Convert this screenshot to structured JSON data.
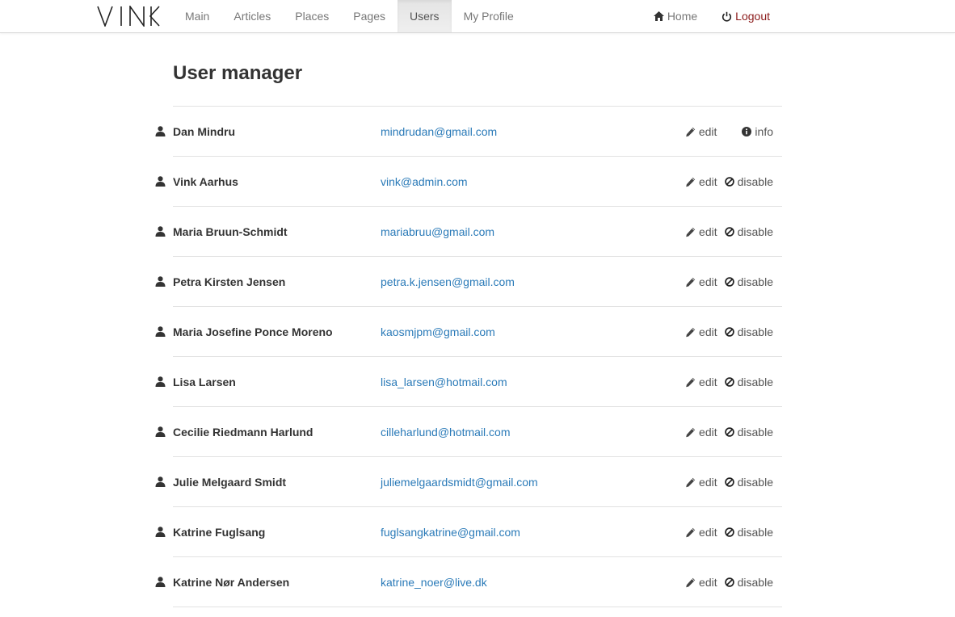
{
  "brand": {
    "logo_text": "VINK"
  },
  "nav": {
    "items": [
      {
        "label": "Main"
      },
      {
        "label": "Articles"
      },
      {
        "label": "Places"
      },
      {
        "label": "Pages"
      },
      {
        "label": "Users",
        "active": true
      },
      {
        "label": "My Profile"
      }
    ],
    "home_label": "Home",
    "logout_label": "Logout"
  },
  "page": {
    "title": "User manager"
  },
  "actions": {
    "edit": "edit",
    "disable": "disable",
    "info": "info"
  },
  "users": [
    {
      "name": "Dan Mindru",
      "email": "mindrudan@gmail.com",
      "secondary": "info"
    },
    {
      "name": "Vink Aarhus",
      "email": "vink@admin.com",
      "secondary": "disable"
    },
    {
      "name": "Maria Bruun-Schmidt",
      "email": "mariabruu@gmail.com",
      "secondary": "disable"
    },
    {
      "name": "Petra Kirsten Jensen",
      "email": "petra.k.jensen@gmail.com",
      "secondary": "disable"
    },
    {
      "name": "Maria Josefine Ponce Moreno",
      "email": "kaosmjpm@gmail.com",
      "secondary": "disable"
    },
    {
      "name": "Lisa Larsen",
      "email": "lisa_larsen@hotmail.com",
      "secondary": "disable"
    },
    {
      "name": "Cecilie Riedmann Harlund",
      "email": "cilleharlund@hotmail.com",
      "secondary": "disable"
    },
    {
      "name": "Julie Melgaard Smidt",
      "email": "juliemelgaardsmidt@gmail.com",
      "secondary": "disable"
    },
    {
      "name": "Katrine Fuglsang",
      "email": "fuglsangkatrine@gmail.com",
      "secondary": "disable"
    },
    {
      "name": "Katrine Nør Andersen",
      "email": "katrine_noer@live.dk",
      "secondary": "disable"
    }
  ],
  "colors": {
    "link": "#2a7ab8",
    "logout": "#8b1a1a",
    "active_tab": "#e7e7e7"
  }
}
